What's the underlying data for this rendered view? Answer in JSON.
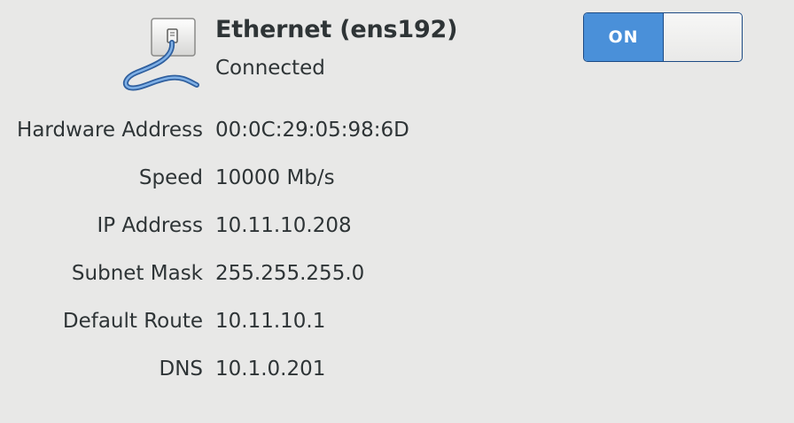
{
  "device": {
    "icon": "ethernet-cable-icon",
    "name": "Ethernet (ens192)",
    "status": "Connected"
  },
  "toggle": {
    "state_label": "ON",
    "on": true,
    "accent_color": "#4a90d9"
  },
  "details": [
    {
      "label": "Hardware Address",
      "value": "00:0C:29:05:98:6D"
    },
    {
      "label": "Speed",
      "value": "10000 Mb/s"
    },
    {
      "label": "IP Address",
      "value": "10.11.10.208"
    },
    {
      "label": "Subnet Mask",
      "value": "255.255.255.0"
    },
    {
      "label": "Default Route",
      "value": "10.11.10.1"
    },
    {
      "label": "DNS",
      "value": "10.1.0.201"
    }
  ]
}
